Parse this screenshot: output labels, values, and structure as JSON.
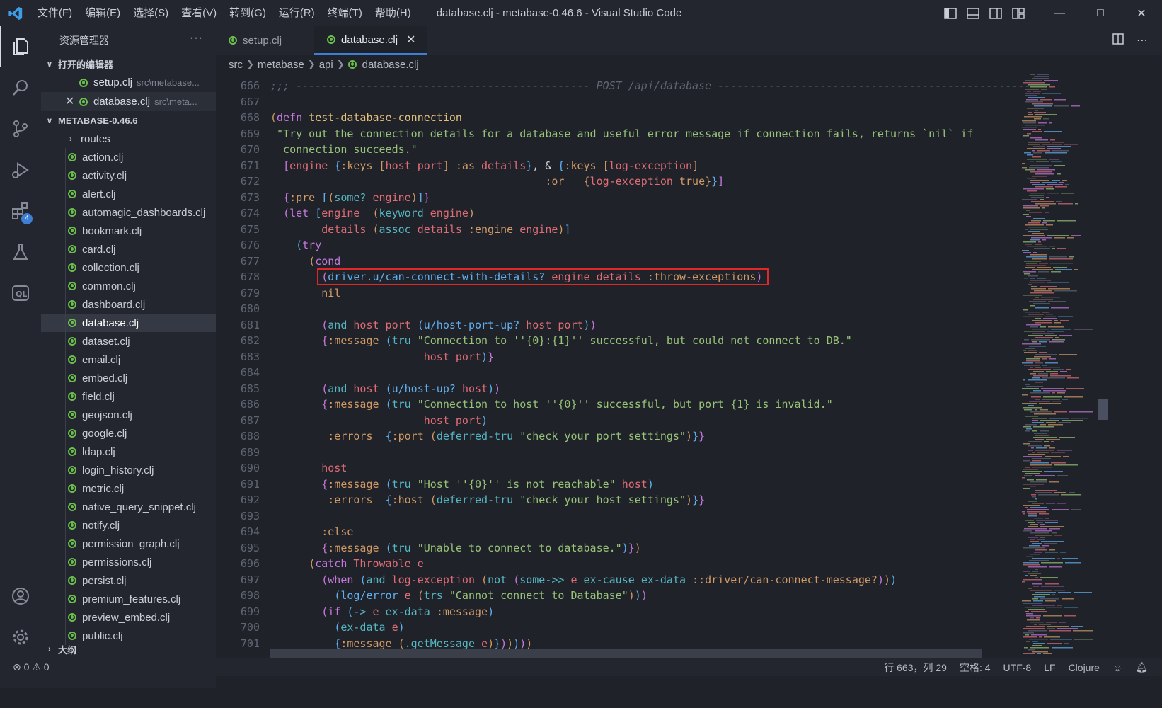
{
  "window": {
    "title": "database.clj - metabase-0.46.6 - Visual Studio Code",
    "menu": [
      "文件(F)",
      "编辑(E)",
      "选择(S)",
      "查看(V)",
      "转到(G)",
      "运行(R)",
      "终端(T)",
      "帮助(H)"
    ]
  },
  "activity": {
    "extensions_badge": "4"
  },
  "sidebar": {
    "title": "资源管理器",
    "more": "···",
    "open_editors_label": "打开的编辑器",
    "open_editors": [
      {
        "name": "setup.clj",
        "path": "src\\metabase..."
      },
      {
        "name": "database.clj",
        "path": "src\\meta..."
      }
    ],
    "project_label": "METABASE-0.46.6",
    "folder": "routes",
    "files": [
      "action.clj",
      "activity.clj",
      "alert.clj",
      "automagic_dashboards.clj",
      "bookmark.clj",
      "card.clj",
      "collection.clj",
      "common.clj",
      "dashboard.clj",
      "database.clj",
      "dataset.clj",
      "email.clj",
      "embed.clj",
      "field.clj",
      "geojson.clj",
      "google.clj",
      "ldap.clj",
      "login_history.clj",
      "metric.clj",
      "native_query_snippet.clj",
      "notify.clj",
      "permission_graph.clj",
      "permissions.clj",
      "persist.clj",
      "premium_features.clj",
      "preview_embed.clj",
      "public.clj"
    ],
    "outline_label": "大纲"
  },
  "tabs": [
    {
      "label": "setup.clj"
    },
    {
      "label": "database.clj"
    }
  ],
  "breadcrumb": [
    "src",
    "metabase",
    "api",
    "database.clj"
  ],
  "editor": {
    "line_numbers": [
      "666",
      "667",
      "668",
      "669",
      "670",
      "671",
      "672",
      "673",
      "674",
      "675",
      "676",
      "677",
      "678",
      "679",
      "680",
      "681",
      "682",
      "683",
      "684",
      "685",
      "686",
      "687",
      "688",
      "689",
      "690",
      "691",
      "692",
      "693",
      "694",
      "695",
      "696",
      "697",
      "698",
      "699",
      "700",
      "701"
    ]
  },
  "status": {
    "errors": "0",
    "warnings": "0",
    "position": "行 663，列 29",
    "spaces": "空格: 4",
    "encoding": "UTF-8",
    "eol": "LF",
    "language": "Clojure"
  }
}
